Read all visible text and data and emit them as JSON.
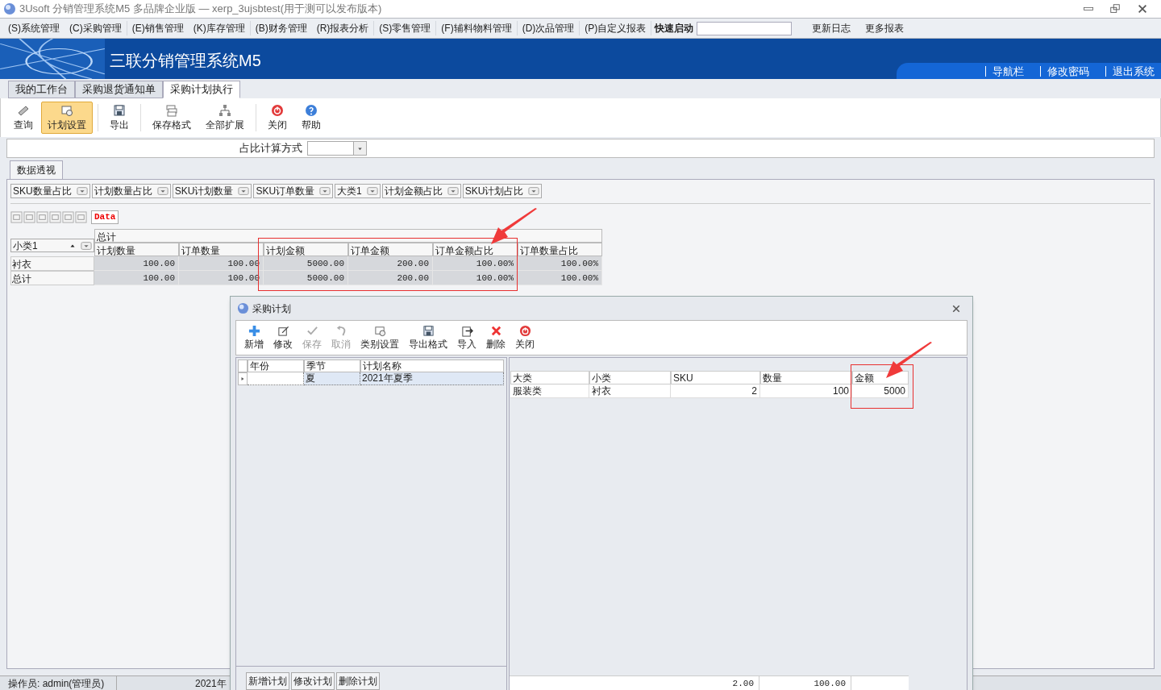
{
  "window": {
    "title": "3Usoft 分销管理系统M5 多品牌企业版 — xerp_3ujsbtest(用于测可以发布版本)"
  },
  "menu": {
    "items": [
      "(S)系统管理",
      "(C)采购管理",
      "(E)销售管理",
      "(K)库存管理",
      "(B)财务管理",
      "(R)报表分析",
      "(S)零售管理",
      "(F)辅料物料管理",
      "(D)次品管理",
      "(P)自定义报表"
    ],
    "quick_launch": "快速启动",
    "links": [
      "更新日志",
      "更多报表"
    ]
  },
  "banner": {
    "title": "三联分销管理系统M5",
    "links": [
      "导航栏",
      "修改密码",
      "退出系统"
    ]
  },
  "tabs": [
    {
      "label": "我的工作台",
      "selected": false
    },
    {
      "label": "采购退货通知单",
      "selected": false
    },
    {
      "label": "采购计划执行",
      "selected": true
    }
  ],
  "toolbar": [
    {
      "label": "查询",
      "kind": "query",
      "selected": false
    },
    {
      "label": "计划设置",
      "kind": "settings",
      "selected": true
    },
    {
      "label": "导出",
      "kind": "save",
      "selected": false
    },
    {
      "label": "保存格式",
      "kind": "layers",
      "selected": false
    },
    {
      "label": "全部扩展",
      "kind": "tree",
      "selected": false
    },
    {
      "label": "关闭",
      "kind": "close",
      "selected": false
    },
    {
      "label": "帮助",
      "kind": "help",
      "selected": false
    }
  ],
  "filter": {
    "label": "占比计算方式"
  },
  "pivot_tab": "数据透视",
  "field_buttons": [
    "SKU数量占比",
    "计划数量占比",
    "SKU计划数量",
    "SKU订单数量",
    "大类1",
    "计划金额占比",
    "SKU计划占比"
  ],
  "data_button": "Data",
  "pivot": {
    "row_field": "小类1",
    "column_header": "总计",
    "columns": [
      "计划数量",
      "订单数量",
      "计划金额",
      "订单金额",
      "订单金额占比",
      "订单数量占比"
    ],
    "rows": [
      {
        "label": "衬衣",
        "cells": [
          "100.00",
          "100.00",
          "5000.00",
          "200.00",
          "100.00%",
          "100.00%"
        ]
      },
      {
        "label": "总计",
        "cells": [
          "100.00",
          "100.00",
          "5000.00",
          "200.00",
          "100.00%",
          "100.00%"
        ]
      }
    ]
  },
  "dialog": {
    "title": "采购计划",
    "toolbar": [
      {
        "label": "新增",
        "kind": "add",
        "disabled": false
      },
      {
        "label": "修改",
        "kind": "edit",
        "disabled": false
      },
      {
        "label": "保存",
        "kind": "check",
        "disabled": true
      },
      {
        "label": "取消",
        "kind": "undo",
        "disabled": true
      },
      {
        "label": "类别设置",
        "kind": "settings",
        "disabled": false
      },
      {
        "label": "导出格式",
        "kind": "save",
        "disabled": false
      },
      {
        "label": "导入",
        "kind": "import",
        "disabled": false
      },
      {
        "label": "删除",
        "kind": "delete",
        "disabled": false
      },
      {
        "label": "关闭",
        "kind": "close",
        "disabled": false
      }
    ],
    "plans": {
      "columns": [
        "年份",
        "季节",
        "计划名称"
      ],
      "rows": [
        {
          "cells": [
            "",
            "夏",
            "2021年夏季"
          ],
          "selected": true
        }
      ]
    },
    "details": {
      "columns": [
        "大类",
        "小类",
        "SKU",
        "数量",
        "金额"
      ],
      "rows": [
        {
          "cells": [
            "服装类",
            "衬衣",
            "2",
            "100",
            "5000"
          ]
        }
      ],
      "totals": [
        "2.00",
        "100.00"
      ]
    },
    "buttons": [
      "新增计划",
      "修改计划",
      "删除计划"
    ]
  },
  "status_bar": {
    "operator": "操作员: admin(管理员)",
    "date": "2021年"
  }
}
